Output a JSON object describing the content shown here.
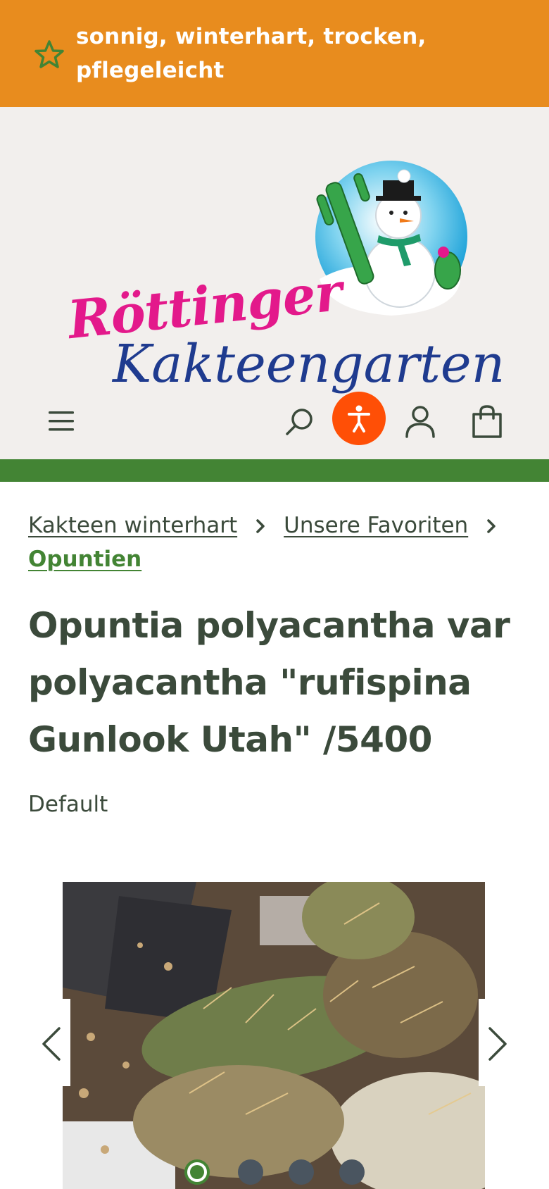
{
  "banner": {
    "text": "sonnig, winterhart, trocken, pflegeleicht",
    "icon": "star-icon",
    "color": "#e88c1e"
  },
  "logo": {
    "line1": "Röttinger",
    "line2": "Kakteengarten"
  },
  "header": {
    "icons": [
      "menu-icon",
      "search-icon",
      "accessibility-icon",
      "account-icon",
      "cart-icon"
    ],
    "accessibility_color": "#ff4f06"
  },
  "accent_color": "#438434",
  "breadcrumb": {
    "items": [
      "Kakteen winterhart",
      "Unsere Favoriten",
      "Opuntien"
    ]
  },
  "product": {
    "title": "Opuntia polyacantha var polyacantha \"rufispina Gunlook Utah\" /5400",
    "variant": "Default"
  },
  "gallery": {
    "image_count": 4,
    "active_index": 0
  }
}
